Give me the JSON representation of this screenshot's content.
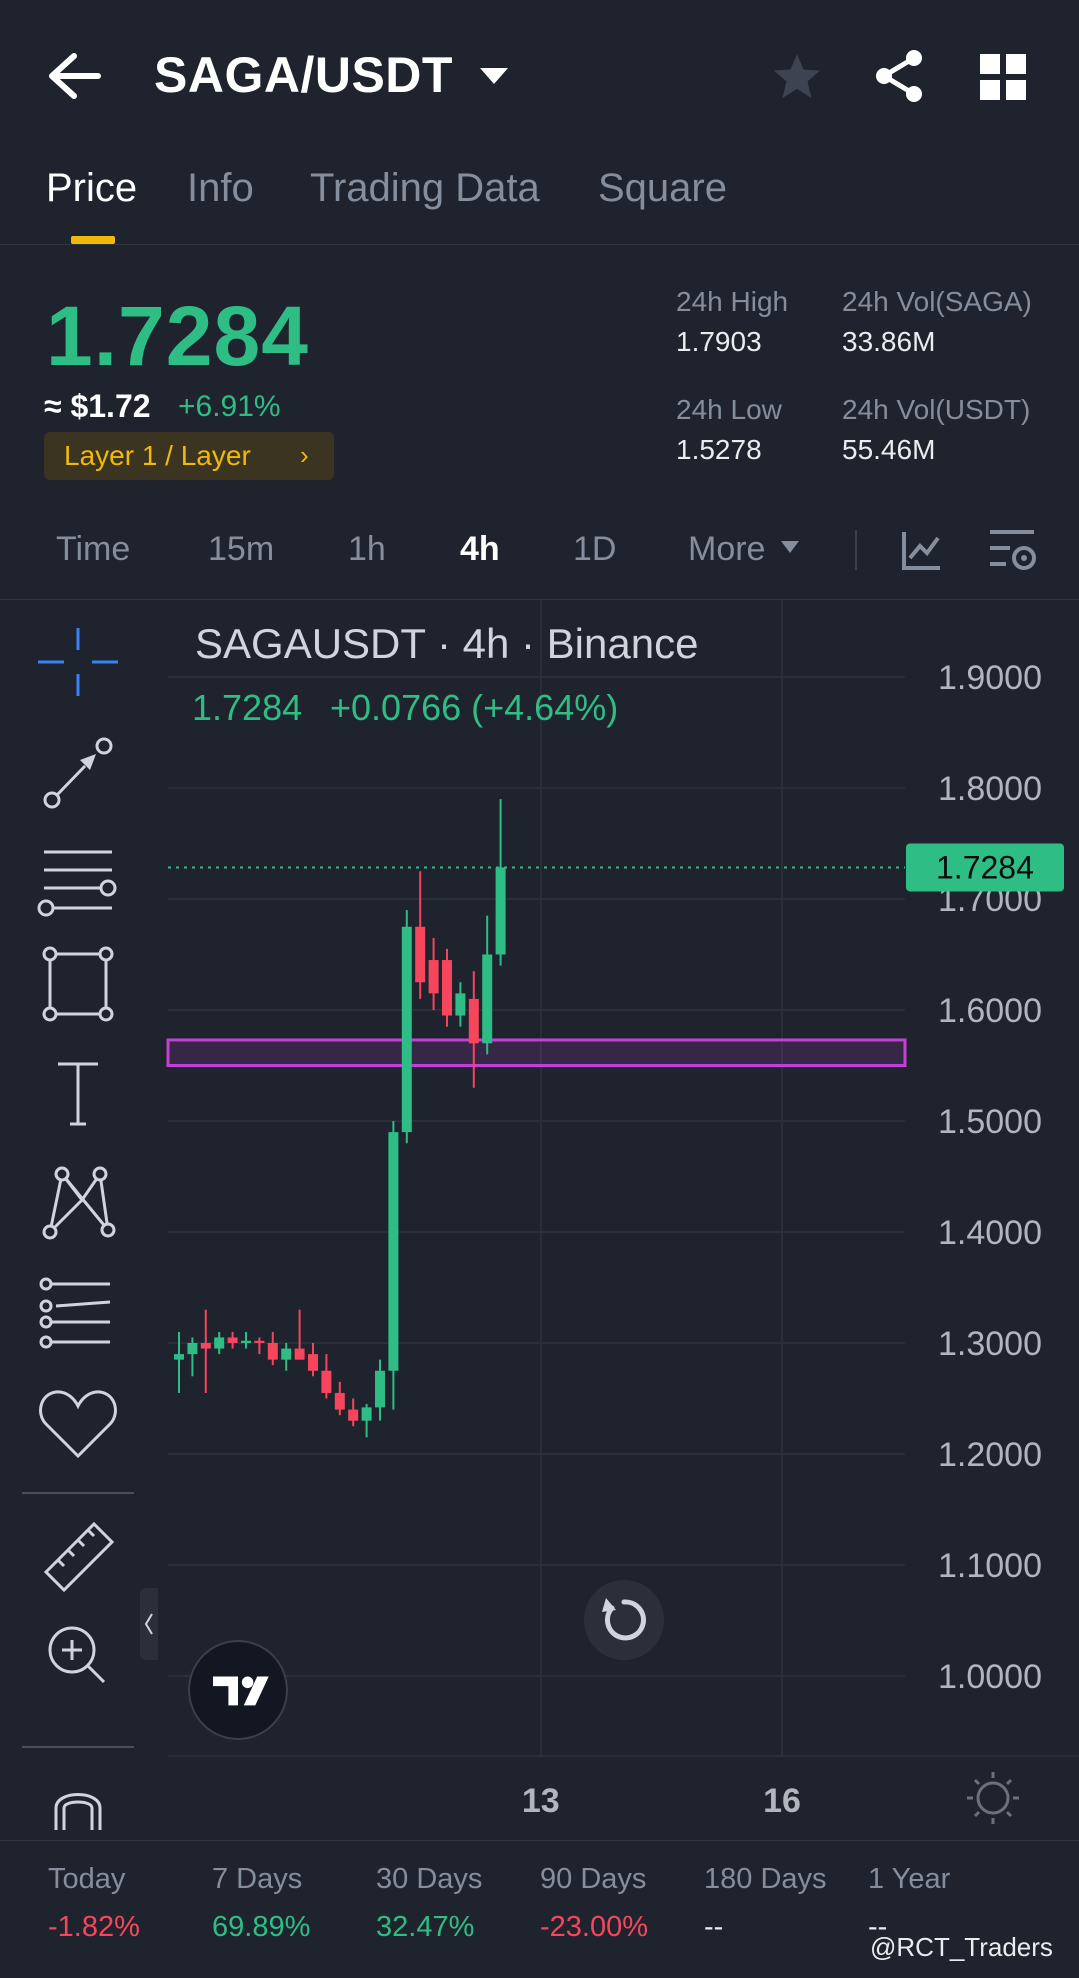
{
  "header": {
    "pair": "SAGA/USDT",
    "icons": [
      "back-arrow-icon",
      "dropdown-caret-icon",
      "star-icon",
      "share-icon",
      "grid-icon"
    ]
  },
  "tabs": [
    {
      "label": "Price",
      "active": true
    },
    {
      "label": "Info",
      "active": false
    },
    {
      "label": "Trading Data",
      "active": false
    },
    {
      "label": "Square",
      "active": false
    }
  ],
  "ticker": {
    "last_price": "1.7284",
    "usd_price": "≈ $1.72",
    "change_pct": "+6.91%",
    "tag": "Layer 1 / Layer",
    "high_label": "24h High",
    "high_value": "1.7903",
    "low_label": "24h Low",
    "low_value": "1.5278",
    "vol_base_label": "24h Vol(SAGA)",
    "vol_base_value": "33.86M",
    "vol_quote_label": "24h Vol(USDT)",
    "vol_quote_value": "55.46M"
  },
  "intervals": {
    "items": [
      "Time",
      "15m",
      "1h",
      "4h",
      "1D",
      "More"
    ],
    "active": "4h"
  },
  "chart_header": {
    "title": "SAGAUSDT · 4h · Binance",
    "last": "1.7284",
    "change": "+0.0766 (+4.64%)"
  },
  "chart_data": {
    "type": "candlestick",
    "symbol": "SAGAUSDT",
    "interval": "4h",
    "exchange": "Binance",
    "ylim": [
      0.95,
      1.95
    ],
    "y_ticks": [
      "1.9000",
      "1.8000",
      "1.7000",
      "1.6000",
      "1.5000",
      "1.4000",
      "1.3000",
      "1.2000",
      "1.1000",
      "1.0000"
    ],
    "x_ticks": [
      {
        "label": "13",
        "index": 27
      },
      {
        "label": "16",
        "index": 45
      }
    ],
    "current_price": "1.7284",
    "zone": {
      "low": 1.55,
      "high": 1.573,
      "color": "#c340d8"
    },
    "candles": [
      {
        "o": 1.285,
        "h": 1.31,
        "l": 1.255,
        "c": 1.29
      },
      {
        "o": 1.29,
        "h": 1.305,
        "l": 1.27,
        "c": 1.3
      },
      {
        "o": 1.3,
        "h": 1.33,
        "l": 1.255,
        "c": 1.295
      },
      {
        "o": 1.295,
        "h": 1.31,
        "l": 1.29,
        "c": 1.305
      },
      {
        "o": 1.305,
        "h": 1.31,
        "l": 1.295,
        "c": 1.3
      },
      {
        "o": 1.3,
        "h": 1.31,
        "l": 1.295,
        "c": 1.302
      },
      {
        "o": 1.302,
        "h": 1.305,
        "l": 1.29,
        "c": 1.3
      },
      {
        "o": 1.3,
        "h": 1.31,
        "l": 1.28,
        "c": 1.285
      },
      {
        "o": 1.285,
        "h": 1.3,
        "l": 1.275,
        "c": 1.295
      },
      {
        "o": 1.295,
        "h": 1.33,
        "l": 1.285,
        "c": 1.285
      },
      {
        "o": 1.29,
        "h": 1.3,
        "l": 1.27,
        "c": 1.275
      },
      {
        "o": 1.275,
        "h": 1.29,
        "l": 1.25,
        "c": 1.255
      },
      {
        "o": 1.255,
        "h": 1.265,
        "l": 1.235,
        "c": 1.24
      },
      {
        "o": 1.24,
        "h": 1.25,
        "l": 1.225,
        "c": 1.23
      },
      {
        "o": 1.23,
        "h": 1.245,
        "l": 1.215,
        "c": 1.242
      },
      {
        "o": 1.242,
        "h": 1.285,
        "l": 1.23,
        "c": 1.275
      },
      {
        "o": 1.275,
        "h": 1.5,
        "l": 1.24,
        "c": 1.49
      },
      {
        "o": 1.49,
        "h": 1.69,
        "l": 1.48,
        "c": 1.675
      },
      {
        "o": 1.675,
        "h": 1.725,
        "l": 1.61,
        "c": 1.625
      },
      {
        "o": 1.645,
        "h": 1.665,
        "l": 1.6,
        "c": 1.615
      },
      {
        "o": 1.645,
        "h": 1.655,
        "l": 1.585,
        "c": 1.595
      },
      {
        "o": 1.595,
        "h": 1.625,
        "l": 1.585,
        "c": 1.615
      },
      {
        "o": 1.61,
        "h": 1.635,
        "l": 1.53,
        "c": 1.57
      },
      {
        "o": 1.57,
        "h": 1.685,
        "l": 1.56,
        "c": 1.65
      },
      {
        "o": 1.65,
        "h": 1.79,
        "l": 1.64,
        "c": 1.7284
      }
    ]
  },
  "toolbar": {
    "icons": [
      "crosshair-icon",
      "trend-line-icon",
      "horizontal-lines-icon",
      "rectangle-icon",
      "text-icon",
      "pattern-icon",
      "fib-icon",
      "favorite-icon",
      "ruler-icon",
      "zoom-in-icon",
      "magnet-icon"
    ]
  },
  "performance": [
    {
      "label": "Today",
      "value": "-1.82%",
      "color": "#f6465d"
    },
    {
      "label": "7 Days",
      "value": "69.89%",
      "color": "#2ebd85"
    },
    {
      "label": "30 Days",
      "value": "32.47%",
      "color": "#2ebd85"
    },
    {
      "label": "90 Days",
      "value": "-23.00%",
      "color": "#f6465d"
    },
    {
      "label": "180 Days",
      "value": "--",
      "color": "#eaecef"
    },
    {
      "label": "1 Year",
      "value": "--",
      "color": "#eaecef"
    }
  ],
  "watermark": "@RCT_Traders",
  "colors": {
    "up": "#2ebd85",
    "down": "#f6465d",
    "accent": "#f0b90b",
    "bg": "#1f232d"
  }
}
